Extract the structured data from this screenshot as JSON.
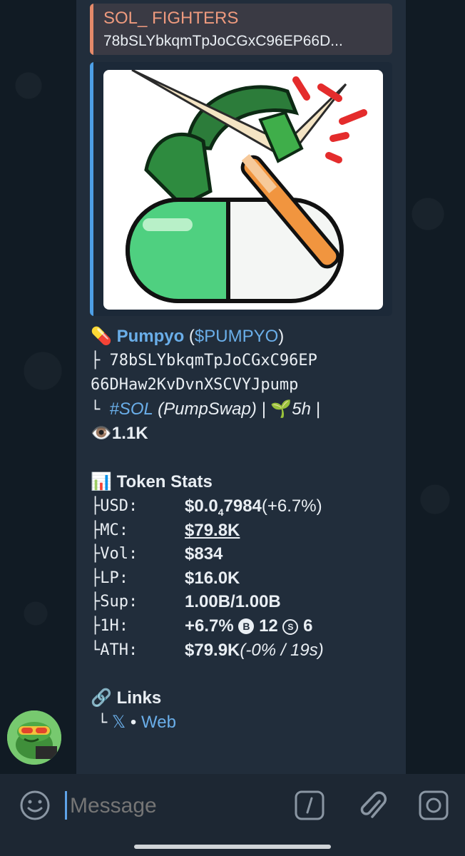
{
  "reply": {
    "name": "SOL_ FIGHTERS",
    "text": "78bSLYbkqmTpJoCGxC96EP66D..."
  },
  "preview": {
    "image_icon": "pill-with-sword-and-bat-sticker"
  },
  "token": {
    "emoji": "💊",
    "name": "Pumpyo",
    "ticker_open": " (",
    "ticker": "$PUMPYO",
    "ticker_close": ")",
    "addr_prefix": "├ ",
    "address_1": "78bSLYbkqmTpJoCGxC96EP",
    "address_2": "66DHaw2KvDvnXSCVYJpump",
    "chain_prefix": "└ ",
    "chain_tag": "#SOL",
    "dex": " (PumpSwap) | ",
    "seedling": "🌱",
    "age": "5h |",
    "eye": "👁️",
    "views": "1.1K"
  },
  "stats": {
    "icon": "📊",
    "title": "Token Stats",
    "rows": [
      {
        "label": "├USD:",
        "value": "$0.0",
        "sub": "4",
        "value_rest": "7984",
        "extra": " (+6.7%)"
      },
      {
        "label": "├MC:",
        "value": "$79.8K"
      },
      {
        "label": "├Vol:",
        "value": "$834"
      },
      {
        "label": "├LP:",
        "value": "$16.0K"
      },
      {
        "label": "├Sup:",
        "value": "1.00B/1.00B"
      },
      {
        "label": "├1H:",
        "value": "+6.7%",
        "b_icon": "B",
        "b_count": "12",
        "s_icon": "S",
        "s_count": "6"
      },
      {
        "label": "└ATH:",
        "value": "$79.9K",
        "extra": " (-0% / 19s)"
      }
    ]
  },
  "links": {
    "icon": "🔗",
    "title": "Links",
    "prefix": "└",
    "x": "𝕏",
    "sep": " • ",
    "web": "Web"
  },
  "input": {
    "placeholder": "Message",
    "emoji_icon": "smile-icon",
    "command_icon": "slash-command-icon",
    "attach_icon": "paperclip-icon",
    "camera_icon": "camera-icon"
  },
  "colors": {
    "accent": "#4d9fe6",
    "reply_accent": "#e58a6a",
    "link": "#6aaee9"
  }
}
